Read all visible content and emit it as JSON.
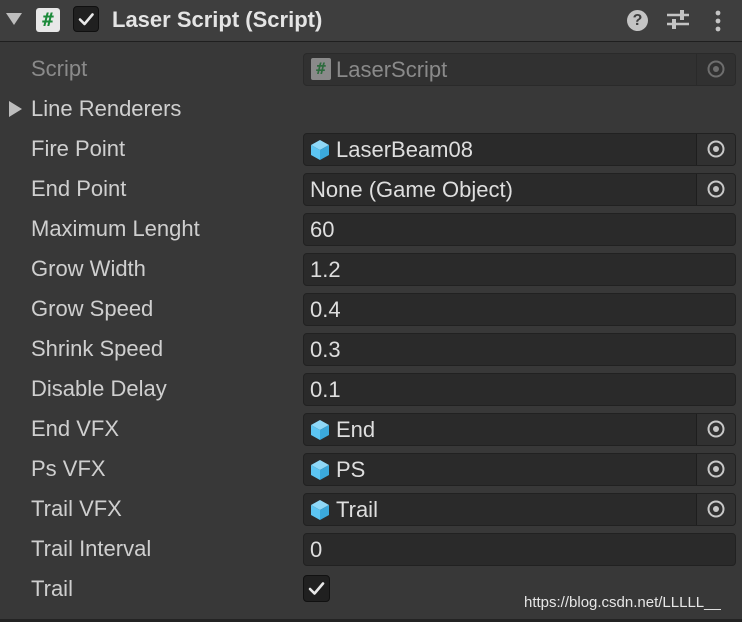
{
  "header": {
    "title": "Laser Script (Script)",
    "enabled": true,
    "help_icon_glyph": "?"
  },
  "properties": {
    "script": {
      "label": "Script",
      "value": "LaserScript"
    },
    "line_renderers": {
      "label": "Line Renderers"
    },
    "fire_point": {
      "label": "Fire Point",
      "value": "LaserBeam08"
    },
    "end_point": {
      "label": "End Point",
      "value": "None (Game Object)"
    },
    "maximum_lenght": {
      "label": "Maximum Lenght",
      "value": "60"
    },
    "grow_width": {
      "label": "Grow Width",
      "value": "1.2"
    },
    "grow_speed": {
      "label": "Grow Speed",
      "value": "0.4"
    },
    "shrink_speed": {
      "label": "Shrink Speed",
      "value": "0.3"
    },
    "disable_delay": {
      "label": "Disable Delay",
      "value": "0.1"
    },
    "end_vfx": {
      "label": "End VFX",
      "value": "End"
    },
    "ps_vfx": {
      "label": "Ps VFX",
      "value": "PS"
    },
    "trail_vfx": {
      "label": "Trail VFX",
      "value": "Trail"
    },
    "trail_interval": {
      "label": "Trail Interval",
      "value": "0"
    },
    "trail": {
      "label": "Trail",
      "checked": true
    }
  },
  "watermark": "https://blog.csdn.net/LLLLL__",
  "colors": {
    "background": "#383838",
    "header": "#3e3e3e",
    "field": "#2a2a2a",
    "text": "#cfcfcf",
    "disabled_text": "#8a8a8a",
    "prefab_icon": "#5cc5f2"
  }
}
